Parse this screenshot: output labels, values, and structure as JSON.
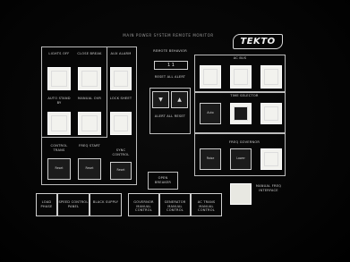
{
  "header": {
    "title": "MAIN POWER SYSTEM REMOTE MONITOR"
  },
  "logo": {
    "text": "TEKTO"
  },
  "left_panel": {
    "buttons": [
      {
        "label": "LIGHTS OFF"
      },
      {
        "label": "CLOSE BREAK"
      },
      {
        "label": "AUX ALARM"
      },
      {
        "label": "AUTO STAND BY"
      },
      {
        "label": "MANUAL OVR"
      },
      {
        "label": "LOCK SHEET"
      },
      {
        "label": "CONTROL TRANS"
      },
      {
        "label": "FREQ START"
      },
      {
        "label": "SYNC CONTROL"
      }
    ],
    "row3_keys": [
      {
        "label": "Reset"
      },
      {
        "label": "Reset"
      },
      {
        "label": "Reset"
      }
    ]
  },
  "center_panel": {
    "remote_label": "REMOTE BEHAVIOR",
    "remote_value": "1 1",
    "reset_label": "RESET ALL ALERT",
    "arrow_down": "▼",
    "arrow_up": "▲",
    "alert_label": "ALERT ALL RESET",
    "open_breaker_label": "OPEN BREAKER"
  },
  "right_panel": {
    "group1_title": "AC BUS",
    "group2_title": "TIME SELECTOR",
    "group2_keys": [
      {
        "label": "Auto"
      },
      {
        "label": ""
      },
      {
        "label": ""
      }
    ],
    "group3_title": "FREQ GOVERNOR",
    "group3_keys": [
      {
        "label": "Raise"
      },
      {
        "label": "Lower"
      },
      {
        "label": ""
      }
    ],
    "manual_label": "MANUAL FREQ INTERFACE"
  },
  "bottom_bar": {
    "buttons": [
      {
        "label": "LOAD PHASE"
      },
      {
        "label": "SPEED CONTROL PANEL"
      },
      {
        "label": "BLACK SUPPLY"
      },
      {
        "label": "GOVERNOR MANUAL CONTROL"
      },
      {
        "label": "GENERATOR MANUAL CONTROL"
      },
      {
        "label": "AC TRANS MANUAL CONTROL"
      }
    ]
  }
}
